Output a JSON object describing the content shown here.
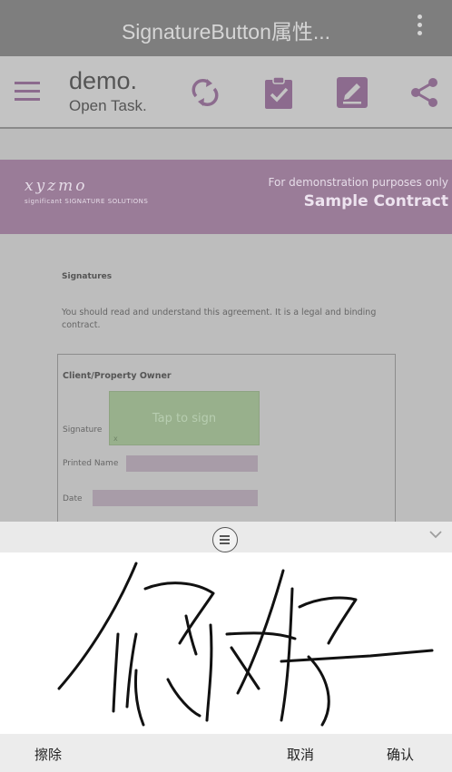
{
  "titlebar": {
    "title": "SignatureButton属性..."
  },
  "appbar": {
    "title": "demo.",
    "subtitle": "Open Task."
  },
  "document": {
    "logo_text": "xyzmo",
    "logo_tagline": "significant SIGNATURE SOLUTIONS",
    "demo_note": "For demonstration purposes only",
    "contract_title": "Sample Contract",
    "signatures_heading": "Signatures",
    "intro_text": "You should read and understand this agreement. It is a legal and binding contract.",
    "box_title": "Client/Property Owner",
    "signature_label": "Signature",
    "tap_to_sign": "Tap to sign",
    "sign_marker": "x",
    "printed_name_label": "Printed Name",
    "date_label": "Date"
  },
  "actions": {
    "erase": "擦除",
    "cancel": "取消",
    "confirm": "确认"
  },
  "colors": {
    "accent": "#8c6b8e",
    "header_band": "#9a7c98",
    "sign_area": "#98b08c"
  }
}
